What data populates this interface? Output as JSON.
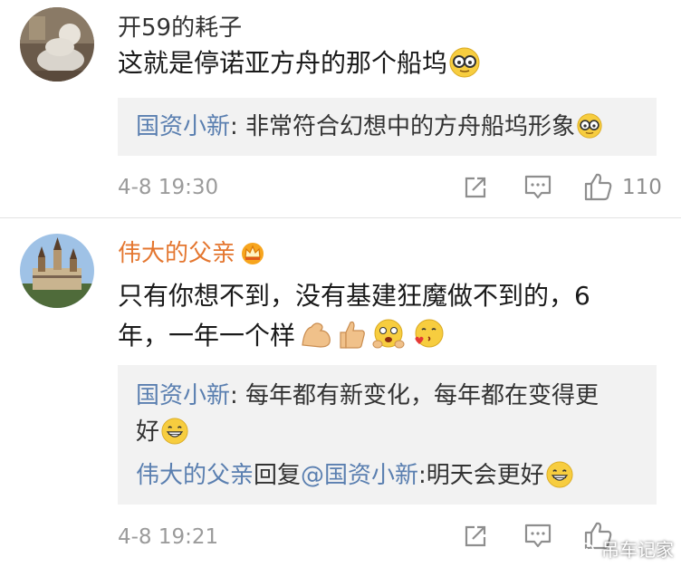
{
  "comments": [
    {
      "username": "开59的耗子",
      "text": "这就是停诺亚方舟的那个船坞",
      "reply": {
        "lines": [
          {
            "name": "国资小新",
            "sep": ": ",
            "text": "非常符合幻想中的方舟船坞形象"
          }
        ]
      },
      "timestamp": "4-8 19:30",
      "like_count": "110"
    },
    {
      "username": "伟大的父亲",
      "text_line1": "只有你想不到，没有基建狂魔做不到的，6",
      "text_line2": "年，一年一个样",
      "reply": {
        "line1_name": "国资小新",
        "line1_sep": ": ",
        "line1_text": "每年都有新变化，每年都在变得更",
        "line2_text": "好",
        "line3_name": "伟大的父亲",
        "line3_mid": "回复",
        "line3_at": "@国资小新",
        "line3_text": ":明天会更好"
      },
      "timestamp": "4-8 19:21"
    }
  ],
  "watermark": "吊车记家",
  "icons": {
    "share": "share-icon",
    "comment": "comment-icon",
    "like": "thumbs-up-icon",
    "vip_badge": "crown-badge-icon",
    "emoji_nerd": "nerd-glasses-emoji",
    "emoji_grin": "grin-emoji",
    "emoji_muscle": "muscle-emoji",
    "emoji_thumb": "thumbs-up-emoji",
    "emoji_hug": "hug-emoji",
    "emoji_kiss": "kiss-emoji"
  },
  "colors": {
    "reply_name": "#5a7fb0",
    "vip_name": "#e4762f",
    "meta_text": "#9b9b9b",
    "reply_bg": "#f2f2f2"
  }
}
